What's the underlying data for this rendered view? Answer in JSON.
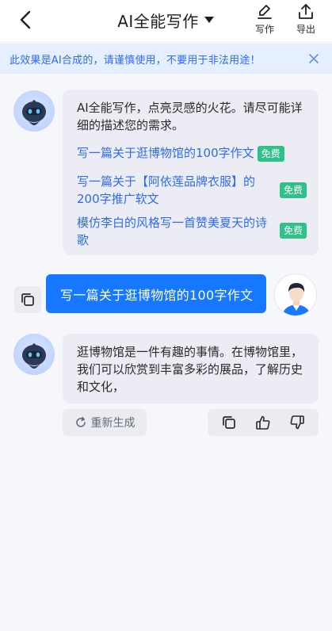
{
  "header": {
    "title": "AI全能写作",
    "actions": [
      {
        "label": "写作",
        "icon": "pen-icon"
      },
      {
        "label": "导出",
        "icon": "export-icon"
      }
    ]
  },
  "notice": {
    "text": "此效果是AI合成的，请谨慎使用，不要用于非法用途！"
  },
  "bot_message": {
    "intro": "AI全能写作，点亮灵感的火花。请尽可能详细的描述您的需求。",
    "suggestions": [
      {
        "text": "写一篇关于逛博物馆的100字作文",
        "badge": "免费"
      },
      {
        "text": "写一篇关于【阿依莲品牌衣服】的200字推广软文",
        "badge": "免费"
      },
      {
        "text": "模仿李白的风格写一首赞美夏天的诗歌",
        "badge": "免费"
      }
    ]
  },
  "user_message": {
    "text": "写一篇关于逛博物馆的100字作文"
  },
  "answer": {
    "text": "逛博物馆是一件有趣的事情。在博物馆里，我们可以欣赏到丰富多彩的展品，了解历史和文化，",
    "regenerate_label": "重新生成"
  },
  "colors": {
    "accent": "#1677ff",
    "link": "#2f6bf2",
    "badge": "#30c08a",
    "notice_bg": "#e6efff",
    "bubble_bg": "#ecedf4",
    "page_bg": "#f6f7fb"
  }
}
